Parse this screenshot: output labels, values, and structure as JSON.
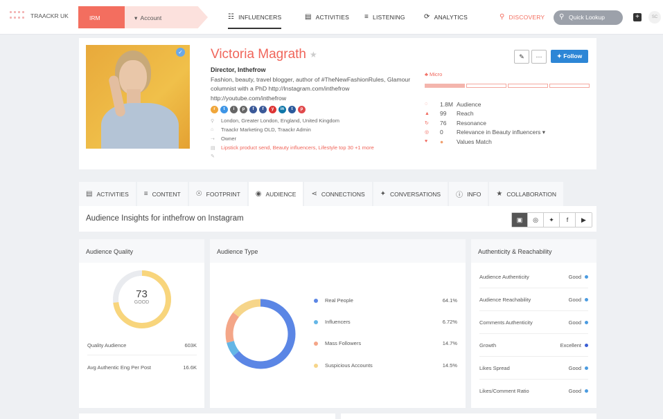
{
  "topbar": {
    "brand": "TRAACKR UK",
    "irm": "IRM",
    "account": "Account",
    "nav": [
      {
        "label": "INFLUENCERS",
        "icon": "users-icon"
      },
      {
        "label": "ACTIVITIES",
        "icon": "list-icon"
      },
      {
        "label": "LISTENING",
        "icon": "lines-icon"
      },
      {
        "label": "ANALYTICS",
        "icon": "sync-icon"
      },
      {
        "label": "DISCOVERY",
        "icon": "search-people-icon"
      }
    ],
    "lookup_placeholder": "Quick Lookup",
    "user_initials": "SC"
  },
  "profile": {
    "name": "Victoria Magrath",
    "title": "Director, Inthefrow",
    "bio": "Fashion, beauty, travel blogger, author of #TheNewFashionRules, Glamour columnist with a PhD http://Instagram.com/inthefrow http://youtube.com/inthefrow",
    "location": "London, Greater London, England, United Kingdom",
    "owners": "Traackr Marketing OLD, Traackr Admin",
    "owner_role": "Owner",
    "lists": "Lipstick product send, Beauty influencers, Lifestyle top 30 +1 more",
    "follow_label": "Follow",
    "tier_label": "Micro",
    "tier_level": 1,
    "tier_count": 4,
    "metrics": [
      {
        "value": "1.8M",
        "label": "Audience"
      },
      {
        "value": "99",
        "label": "Reach"
      },
      {
        "value": "76",
        "label": "Resonance"
      },
      {
        "value": "0",
        "label": "Relevance in Beauty influencers  ▾"
      },
      {
        "value": "●",
        "label": "Values Match"
      }
    ]
  },
  "tabs": [
    {
      "label": "ACTIVITIES",
      "icon": "list-icon"
    },
    {
      "label": "CONTENT",
      "icon": "lines-icon"
    },
    {
      "label": "FOOTPRINT",
      "icon": "globe-icon"
    },
    {
      "label": "AUDIENCE",
      "icon": "eye-icon"
    },
    {
      "label": "CONNECTIONS",
      "icon": "share-icon"
    },
    {
      "label": "CONVERSATIONS",
      "icon": "twitter-icon"
    },
    {
      "label": "INFO",
      "icon": "info-icon"
    },
    {
      "label": "COLLABORATION",
      "icon": "star-icon"
    }
  ],
  "insights_title": "Audience Insights for inthefrow on Instagram",
  "quality": {
    "heading": "Audience Quality",
    "score": "73",
    "score_label": "GOOD",
    "score_value": 73,
    "rows": [
      {
        "label": "Quality Audience",
        "value": "603K"
      },
      {
        "label": "Avg Authentic Eng Per Post",
        "value": "16.6K"
      }
    ]
  },
  "audience_type": {
    "heading": "Audience Type",
    "rows": [
      {
        "label": "Real People",
        "value": "64.1%",
        "color": "#5b86e5"
      },
      {
        "label": "Influencers",
        "value": "6.72%",
        "color": "#64b6e6"
      },
      {
        "label": "Mass Followers",
        "value": "14.7%",
        "color": "#f4a688"
      },
      {
        "label": "Suspicious Accounts",
        "value": "14.5%",
        "color": "#f6d58a"
      }
    ]
  },
  "chart_data": {
    "type": "pie",
    "categories": [
      "Real People",
      "Influencers",
      "Mass Followers",
      "Suspicious Accounts"
    ],
    "values": [
      64.1,
      6.72,
      14.7,
      14.5
    ],
    "colors": [
      "#5b86e5",
      "#64b6e6",
      "#f4a688",
      "#f6d58a"
    ]
  },
  "authenticity": {
    "heading": "Authenticity & Reachability",
    "rows": [
      {
        "label": "Audience Authenticity",
        "value": "Good"
      },
      {
        "label": "Audience Reachability",
        "value": "Good"
      },
      {
        "label": "Comments Authenticity",
        "value": "Good"
      },
      {
        "label": "Growth",
        "value": "Excellent"
      },
      {
        "label": "Likes Spread",
        "value": "Good"
      },
      {
        "label": "Likes/Comment Ratio",
        "value": "Good"
      }
    ]
  },
  "colors": {
    "accent": "#f0655a",
    "follow": "#2d86d6",
    "good": "#4b9be0",
    "excellent": "#3a5ed4"
  }
}
